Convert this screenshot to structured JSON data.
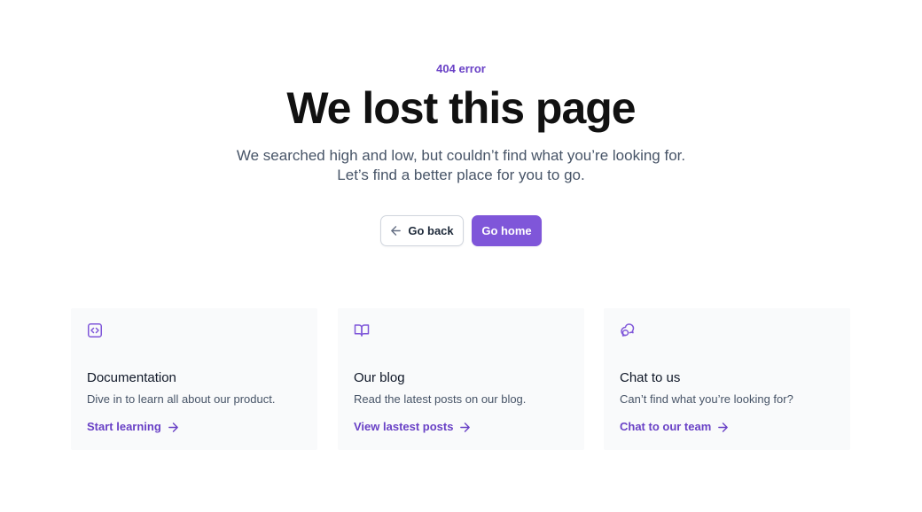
{
  "eyebrow": "404 error",
  "title": "We lost this page",
  "subtitle_line1": "We searched high and low, but couldn’t find what you’re looking for.",
  "subtitle_line2": "Let’s find a better place for you to go.",
  "buttons": {
    "back": {
      "label": "Go back",
      "icon": "arrow-left-icon"
    },
    "home": {
      "label": "Go home"
    }
  },
  "colors": {
    "accent": "#7f56d9",
    "accent_text": "#6941c6",
    "card_bg": "#f9fafb"
  },
  "cards": [
    {
      "icon": "code-square-icon",
      "title": "Documentation",
      "description": "Dive in to learn all about our product.",
      "link": "Start learning"
    },
    {
      "icon": "book-open-icon",
      "title": "Our blog",
      "description": "Read the latest posts on our blog.",
      "link": "View lastest posts"
    },
    {
      "icon": "chat-bubbles-icon",
      "title": "Chat to us",
      "description": "Can’t find what you’re looking for?",
      "link": "Chat to our team"
    }
  ]
}
